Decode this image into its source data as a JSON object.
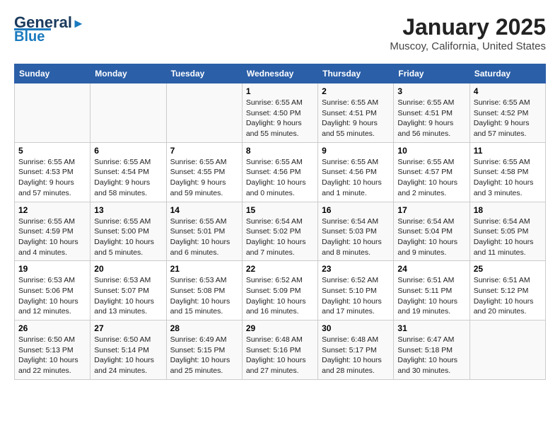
{
  "header": {
    "logo_line1": "General",
    "logo_line2": "Blue",
    "title": "January 2025",
    "subtitle": "Muscoy, California, United States"
  },
  "weekdays": [
    "Sunday",
    "Monday",
    "Tuesday",
    "Wednesday",
    "Thursday",
    "Friday",
    "Saturday"
  ],
  "weeks": [
    [
      {
        "day": "",
        "content": ""
      },
      {
        "day": "",
        "content": ""
      },
      {
        "day": "",
        "content": ""
      },
      {
        "day": "1",
        "content": "Sunrise: 6:55 AM\nSunset: 4:50 PM\nDaylight: 9 hours and 55 minutes."
      },
      {
        "day": "2",
        "content": "Sunrise: 6:55 AM\nSunset: 4:51 PM\nDaylight: 9 hours and 55 minutes."
      },
      {
        "day": "3",
        "content": "Sunrise: 6:55 AM\nSunset: 4:51 PM\nDaylight: 9 hours and 56 minutes."
      },
      {
        "day": "4",
        "content": "Sunrise: 6:55 AM\nSunset: 4:52 PM\nDaylight: 9 hours and 57 minutes."
      }
    ],
    [
      {
        "day": "5",
        "content": "Sunrise: 6:55 AM\nSunset: 4:53 PM\nDaylight: 9 hours and 57 minutes."
      },
      {
        "day": "6",
        "content": "Sunrise: 6:55 AM\nSunset: 4:54 PM\nDaylight: 9 hours and 58 minutes."
      },
      {
        "day": "7",
        "content": "Sunrise: 6:55 AM\nSunset: 4:55 PM\nDaylight: 9 hours and 59 minutes."
      },
      {
        "day": "8",
        "content": "Sunrise: 6:55 AM\nSunset: 4:56 PM\nDaylight: 10 hours and 0 minutes."
      },
      {
        "day": "9",
        "content": "Sunrise: 6:55 AM\nSunset: 4:56 PM\nDaylight: 10 hours and 1 minute."
      },
      {
        "day": "10",
        "content": "Sunrise: 6:55 AM\nSunset: 4:57 PM\nDaylight: 10 hours and 2 minutes."
      },
      {
        "day": "11",
        "content": "Sunrise: 6:55 AM\nSunset: 4:58 PM\nDaylight: 10 hours and 3 minutes."
      }
    ],
    [
      {
        "day": "12",
        "content": "Sunrise: 6:55 AM\nSunset: 4:59 PM\nDaylight: 10 hours and 4 minutes."
      },
      {
        "day": "13",
        "content": "Sunrise: 6:55 AM\nSunset: 5:00 PM\nDaylight: 10 hours and 5 minutes."
      },
      {
        "day": "14",
        "content": "Sunrise: 6:55 AM\nSunset: 5:01 PM\nDaylight: 10 hours and 6 minutes."
      },
      {
        "day": "15",
        "content": "Sunrise: 6:54 AM\nSunset: 5:02 PM\nDaylight: 10 hours and 7 minutes."
      },
      {
        "day": "16",
        "content": "Sunrise: 6:54 AM\nSunset: 5:03 PM\nDaylight: 10 hours and 8 minutes."
      },
      {
        "day": "17",
        "content": "Sunrise: 6:54 AM\nSunset: 5:04 PM\nDaylight: 10 hours and 9 minutes."
      },
      {
        "day": "18",
        "content": "Sunrise: 6:54 AM\nSunset: 5:05 PM\nDaylight: 10 hours and 11 minutes."
      }
    ],
    [
      {
        "day": "19",
        "content": "Sunrise: 6:53 AM\nSunset: 5:06 PM\nDaylight: 10 hours and 12 minutes."
      },
      {
        "day": "20",
        "content": "Sunrise: 6:53 AM\nSunset: 5:07 PM\nDaylight: 10 hours and 13 minutes."
      },
      {
        "day": "21",
        "content": "Sunrise: 6:53 AM\nSunset: 5:08 PM\nDaylight: 10 hours and 15 minutes."
      },
      {
        "day": "22",
        "content": "Sunrise: 6:52 AM\nSunset: 5:09 PM\nDaylight: 10 hours and 16 minutes."
      },
      {
        "day": "23",
        "content": "Sunrise: 6:52 AM\nSunset: 5:10 PM\nDaylight: 10 hours and 17 minutes."
      },
      {
        "day": "24",
        "content": "Sunrise: 6:51 AM\nSunset: 5:11 PM\nDaylight: 10 hours and 19 minutes."
      },
      {
        "day": "25",
        "content": "Sunrise: 6:51 AM\nSunset: 5:12 PM\nDaylight: 10 hours and 20 minutes."
      }
    ],
    [
      {
        "day": "26",
        "content": "Sunrise: 6:50 AM\nSunset: 5:13 PM\nDaylight: 10 hours and 22 minutes."
      },
      {
        "day": "27",
        "content": "Sunrise: 6:50 AM\nSunset: 5:14 PM\nDaylight: 10 hours and 24 minutes."
      },
      {
        "day": "28",
        "content": "Sunrise: 6:49 AM\nSunset: 5:15 PM\nDaylight: 10 hours and 25 minutes."
      },
      {
        "day": "29",
        "content": "Sunrise: 6:48 AM\nSunset: 5:16 PM\nDaylight: 10 hours and 27 minutes."
      },
      {
        "day": "30",
        "content": "Sunrise: 6:48 AM\nSunset: 5:17 PM\nDaylight: 10 hours and 28 minutes."
      },
      {
        "day": "31",
        "content": "Sunrise: 6:47 AM\nSunset: 5:18 PM\nDaylight: 10 hours and 30 minutes."
      },
      {
        "day": "",
        "content": ""
      }
    ]
  ]
}
